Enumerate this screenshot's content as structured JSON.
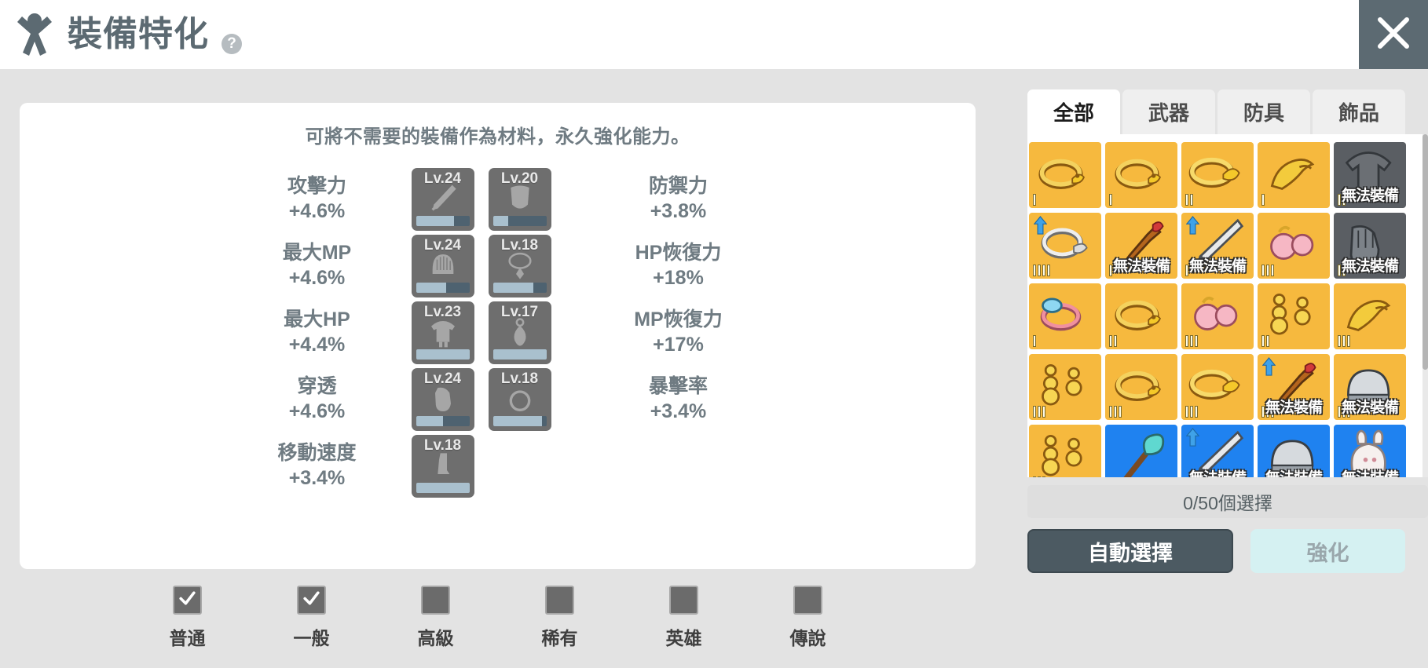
{
  "header": {
    "title": "裝備特化",
    "person_icon": "person-icon",
    "help_icon": "?",
    "close_icon": "close-icon"
  },
  "left_panel": {
    "description": "可將不需要的裝備作為材料，永久強化能力。",
    "stat_rows": [
      {
        "left_label": "攻擊力",
        "left_value": "+4.6%",
        "left_slots": [
          {
            "level": "Lv.24",
            "glyph": "sword-icon",
            "progress": 72
          },
          {
            "level": "Lv.20",
            "glyph": "shield-icon",
            "progress": 28
          }
        ],
        "right_label": "防禦力",
        "right_value": "+3.8%"
      },
      {
        "left_label": "最大MP",
        "left_value": "+4.6%",
        "left_slots": [
          {
            "level": "Lv.24",
            "glyph": "helmet-icon",
            "progress": 56
          },
          {
            "level": "Lv.18",
            "glyph": "necklace-icon",
            "progress": 76
          }
        ],
        "right_label": "HP恢復力",
        "right_value": "+18%"
      },
      {
        "left_label": "最大HP",
        "left_value": "+4.4%",
        "left_slots": [
          {
            "level": "Lv.23",
            "glyph": "armor-icon",
            "progress": 100
          },
          {
            "level": "Lv.17",
            "glyph": "pendant-icon",
            "progress": 100
          }
        ],
        "right_label": "MP恢復力",
        "right_value": "+17%"
      },
      {
        "left_label": "穿透",
        "left_value": "+4.6%",
        "left_slots": [
          {
            "level": "Lv.24",
            "glyph": "glove-icon",
            "progress": 50
          },
          {
            "level": "Lv.18",
            "glyph": "ring-icon",
            "progress": 92
          }
        ],
        "right_label": "暴擊率",
        "right_value": "+3.4%"
      },
      {
        "left_label": "移動速度",
        "left_value": "+3.4%",
        "left_slots": [
          {
            "level": "Lv.18",
            "glyph": "boots-icon",
            "progress": 100
          }
        ],
        "right_label": "",
        "right_value": ""
      }
    ]
  },
  "rarity_filters": [
    {
      "name": "普通",
      "checked": true
    },
    {
      "name": "一般",
      "checked": true
    },
    {
      "name": "高級",
      "checked": false
    },
    {
      "name": "稀有",
      "checked": false
    },
    {
      "name": "英雄",
      "checked": false
    },
    {
      "name": "傳說",
      "checked": false
    }
  ],
  "right_panel": {
    "tabs": [
      {
        "label": "全部",
        "active": true
      },
      {
        "label": "武器",
        "active": false
      },
      {
        "label": "防具",
        "active": false
      },
      {
        "label": "飾品",
        "active": false
      }
    ],
    "locked_text": "無法裝備",
    "count_text": "0/50個選擇",
    "auto_select_label": "自動選擇",
    "enhance_label": "強化",
    "colors": {
      "tile_common": "#f6b93e",
      "tile_rare": "#1f82f0",
      "tile_dark": "#5a5e63",
      "accent_arrow": "#3fa2e8",
      "auto_select_bg": "#4c5a62",
      "enhance_bg": "#d5f1f2",
      "header_close_bg": "#5c6a72"
    },
    "items": [
      {
        "art": "ring-gold-icon",
        "bg": "common",
        "grade": 1,
        "locked": false,
        "arrow": false
      },
      {
        "art": "ring-gold-icon",
        "bg": "common",
        "grade": 1,
        "locked": false,
        "arrow": false
      },
      {
        "art": "ring-ornate-icon",
        "bg": "common",
        "grade": 2,
        "locked": false,
        "arrow": false
      },
      {
        "art": "ring-claw-icon",
        "bg": "common",
        "grade": 1,
        "locked": false,
        "arrow": false
      },
      {
        "art": "armor-icon",
        "bg": "dark",
        "grade": 2,
        "locked": true,
        "arrow": false
      },
      {
        "art": "ring-silver-icon",
        "bg": "common",
        "grade": 4,
        "locked": false,
        "arrow": true
      },
      {
        "art": "dagger-icon",
        "bg": "common",
        "grade": 1,
        "locked": true,
        "arrow": false
      },
      {
        "art": "sword-icon",
        "bg": "common",
        "grade": 1,
        "locked": true,
        "arrow": true
      },
      {
        "art": "earring-pink-icon",
        "bg": "common",
        "grade": 3,
        "locked": false,
        "arrow": false
      },
      {
        "art": "glove-icon",
        "bg": "dark",
        "grade": 2,
        "locked": true,
        "arrow": false
      },
      {
        "art": "ring-pink-icon",
        "bg": "common",
        "grade": 1,
        "locked": false,
        "arrow": false
      },
      {
        "art": "ring-gold-icon",
        "bg": "common",
        "grade": 2,
        "locked": false,
        "arrow": false
      },
      {
        "art": "earring-pink-icon",
        "bg": "common",
        "grade": 3,
        "locked": false,
        "arrow": false
      },
      {
        "art": "earring-gold-icon",
        "bg": "common",
        "grade": 2,
        "locked": false,
        "arrow": false
      },
      {
        "art": "ring-claw-icon",
        "bg": "common",
        "grade": 3,
        "locked": false,
        "arrow": false
      },
      {
        "art": "earring-gold-icon",
        "bg": "common",
        "grade": 3,
        "locked": false,
        "arrow": false
      },
      {
        "art": "ring-gold-icon",
        "bg": "common",
        "grade": 3,
        "locked": false,
        "arrow": false
      },
      {
        "art": "ring-ornate-icon",
        "bg": "common",
        "grade": 3,
        "locked": false,
        "arrow": false
      },
      {
        "art": "dagger-icon",
        "bg": "common",
        "grade": 3,
        "locked": true,
        "arrow": true
      },
      {
        "art": "helmet-icon",
        "bg": "common",
        "grade": 3,
        "locked": true,
        "arrow": false
      },
      {
        "art": "earring-gold-icon",
        "bg": "common",
        "grade": 3,
        "locked": false,
        "arrow": false
      },
      {
        "art": "staff-icon",
        "bg": "rare",
        "grade": 0,
        "locked": false,
        "arrow": false
      },
      {
        "art": "sword-icon",
        "bg": "rare",
        "grade": 0,
        "locked": true,
        "arrow": true
      },
      {
        "art": "helmet-icon",
        "bg": "rare",
        "grade": 0,
        "locked": true,
        "arrow": false
      },
      {
        "art": "hood-icon",
        "bg": "rare",
        "grade": 0,
        "locked": true,
        "arrow": false
      }
    ]
  }
}
